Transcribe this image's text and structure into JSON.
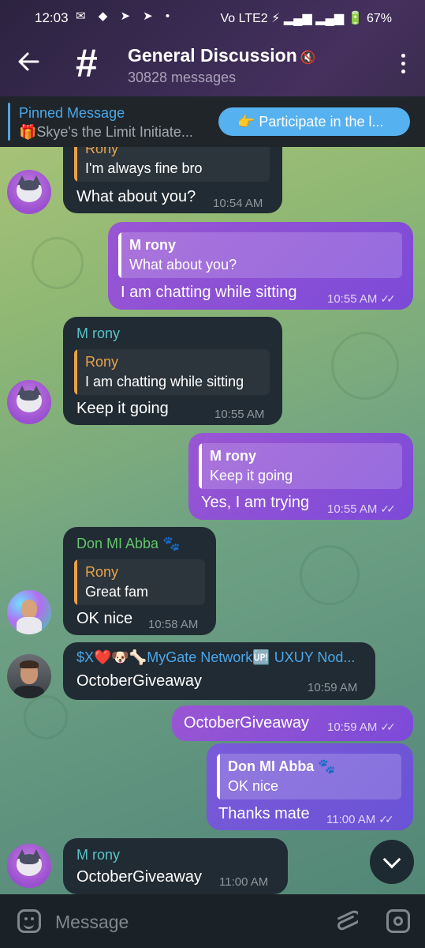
{
  "status_bar": {
    "time": "12:03",
    "left_icons": "✉ ◆ ➤ ➤ •",
    "right_text": "Vo LTE2 ⚡ ▂▄▆ ▂▄▆ 🔋 67%"
  },
  "header": {
    "title": "General Discussion",
    "subtitle": "30828 messages"
  },
  "pinned": {
    "label": "Pinned Message",
    "text": "🎁Skye's the Limit Initiate...",
    "button": "👉 Participate in the l..."
  },
  "messages": [
    {
      "reply_name": "Rony",
      "reply_text": "I'm always fine bro",
      "text": "What about you?",
      "time": "10:54 AM"
    },
    {
      "reply_name": "M rony",
      "reply_text": "What about you?",
      "text": "I am chatting while sitting",
      "time": "10:55 AM"
    },
    {
      "sender": "M rony",
      "reply_name": "Rony",
      "reply_text": "I am chatting while sitting",
      "text": "Keep it going",
      "time": "10:55 AM"
    },
    {
      "reply_name": "M rony",
      "reply_text": "Keep it going",
      "text": "Yes, I am trying",
      "time": "10:55 AM"
    },
    {
      "sender": "Don MI Abba 🐾",
      "reply_name": "Rony",
      "reply_text": "Great fam",
      "text": "OK  nice",
      "time": "10:58 AM"
    },
    {
      "sender": "$X❤️🐶🦴MyGate Network🆙 UXUY Nod...",
      "text": "OctoberGiveaway",
      "time": "10:59 AM"
    },
    {
      "text": "OctoberGiveaway",
      "time": "10:59 AM"
    },
    {
      "reply_name": "Don MI Abba 🐾",
      "reply_text": "OK  nice",
      "text": "Thanks mate",
      "time": "11:00 AM"
    },
    {
      "sender": "M rony",
      "text": "OctoberGiveaway",
      "time": "11:00 AM"
    }
  ],
  "ticks": "✓✓",
  "input": {
    "placeholder": "Message"
  },
  "colors": {
    "header_bg": "#3a2b52",
    "pinned_accent": "#4ba8ea",
    "incoming_bubble": "#212b33",
    "outgoing_bubble": "#8a50d6",
    "sender_teal": "#58c4c8",
    "sender_green": "#62c66a",
    "sender_blue": "#4ba8ea",
    "reply_orange": "#e9a24a"
  }
}
